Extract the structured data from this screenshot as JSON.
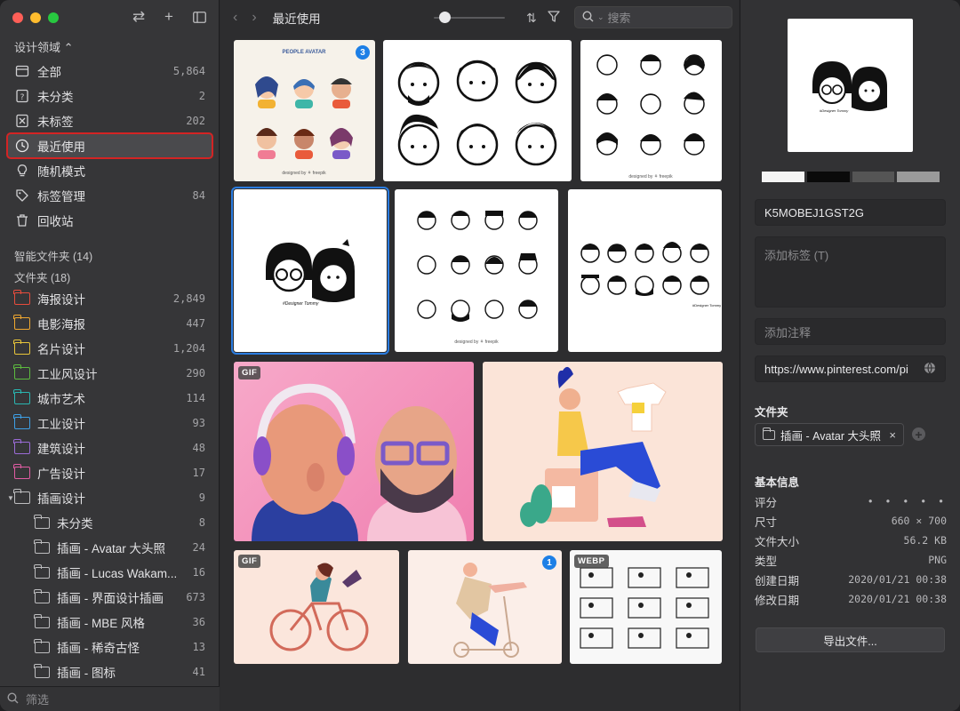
{
  "sidebar": {
    "library_name": "设计领域",
    "nav": [
      {
        "label": "全部",
        "count": "5,864",
        "icon": "all-items-icon"
      },
      {
        "label": "未分类",
        "count": "2",
        "icon": "uncategorized-icon"
      },
      {
        "label": "未标签",
        "count": "202",
        "icon": "untagged-icon"
      },
      {
        "label": "最近使用",
        "count": "",
        "icon": "clock-icon"
      },
      {
        "label": "随机模式",
        "count": "",
        "icon": "lightbulb-icon"
      },
      {
        "label": "标签管理",
        "count": "84",
        "icon": "tag-icon"
      },
      {
        "label": "回收站",
        "count": "",
        "icon": "trash-icon"
      }
    ],
    "smart_folders_label": "智能文件夹 (14)",
    "folders_label": "文件夹 (18)",
    "folders": [
      {
        "label": "海报设计",
        "count": "2,849",
        "color": "#e74c3c"
      },
      {
        "label": "电影海报",
        "count": "447",
        "color": "#f0a830"
      },
      {
        "label": "名片设计",
        "count": "1,204",
        "color": "#e8c53a"
      },
      {
        "label": "工业风设计",
        "count": "290",
        "color": "#5dbb3f"
      },
      {
        "label": "城市艺术",
        "count": "114",
        "color": "#2ab7b2"
      },
      {
        "label": "工业设计",
        "count": "93",
        "color": "#3ea0e6"
      },
      {
        "label": "建筑设计",
        "count": "48",
        "color": "#9b6bd6"
      },
      {
        "label": "广告设计",
        "count": "17",
        "color": "#e05ca3"
      },
      {
        "label": "插画设计",
        "count": "9",
        "color": "#bdbdbf"
      }
    ],
    "subfolders": [
      {
        "label": "未分类",
        "count": "8"
      },
      {
        "label": "插画 - Avatar 大头照",
        "count": "24"
      },
      {
        "label": "插画 - Lucas Wakam...",
        "count": "16"
      },
      {
        "label": "插画 - 界面设计插画",
        "count": "673"
      },
      {
        "label": "插画 - MBE 风格",
        "count": "36"
      },
      {
        "label": "插画 - 稀奇古怪",
        "count": "13"
      },
      {
        "label": "插画 - 图标",
        "count": "41"
      }
    ],
    "filter_placeholder": "筛选"
  },
  "toolbar": {
    "title": "最近使用",
    "search_placeholder": "搜索"
  },
  "grid": {
    "badges": [
      "3",
      "1"
    ],
    "tags": [
      "GIF",
      "GIF",
      "WEBP"
    ],
    "thumb1_title": "PEOPLE AVATAR",
    "freepik_credit": "designed by ⚘ freepik",
    "tommy_caption": "#Designer Tommy"
  },
  "inspector": {
    "name": "K5MOBEJ1GST2G",
    "tags_placeholder": "添加标签 (T)",
    "note_placeholder": "添加注释",
    "url": "https://www.pinterest.com/pi",
    "folder_heading": "文件夹",
    "folder_chip": "插画 - Avatar 大头照",
    "basic_heading": "基本信息",
    "info": [
      {
        "label": "评分",
        "value": "• • • • •"
      },
      {
        "label": "尺寸",
        "value": "660 × 700"
      },
      {
        "label": "文件大小",
        "value": "56.2 KB"
      },
      {
        "label": "类型",
        "value": "PNG"
      },
      {
        "label": "创建日期",
        "value": "2020/01/21 00:38"
      },
      {
        "label": "修改日期",
        "value": "2020/01/21 00:38"
      }
    ],
    "export_label": "导出文件...",
    "palette": [
      "#f4f4f4",
      "#0a0a0a",
      "#555555",
      "#9a9a9a"
    ],
    "preview_caption": "#Designer Tommy"
  },
  "colors": {
    "accent": "#2a7ce0",
    "highlight": "#d32424"
  }
}
